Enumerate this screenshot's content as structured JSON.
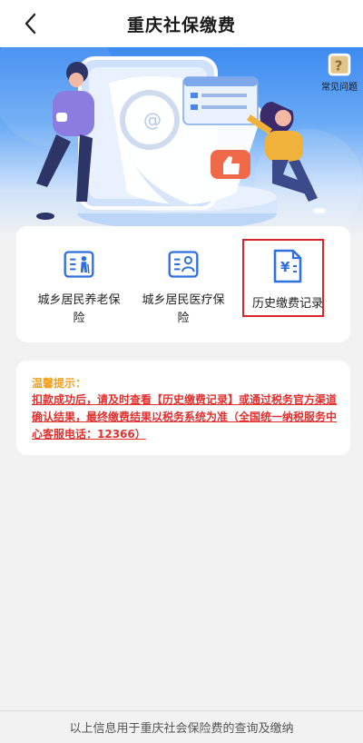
{
  "header": {
    "title": "重庆社保缴费",
    "back_icon": "chevron-left-icon"
  },
  "banner": {
    "faq_label": "常见问题",
    "faq_icon": "help-book-icon"
  },
  "menu": {
    "items": [
      {
        "label": "城乡居民养老保险",
        "icon": "pension-icon"
      },
      {
        "label": "城乡居民医疗保险",
        "icon": "medical-id-icon"
      },
      {
        "label": "历史缴费记录",
        "icon": "yuan-document-icon"
      }
    ]
  },
  "notice": {
    "title": "温馨提示：",
    "body": "扣款成功后，请及时查看【历史缴费记录】或通过税务官方渠道确认结果，最终缴费结果以税务系统为准（全国统一纳税服务中心客服电话：12366）"
  },
  "footer": {
    "text": "以上信息用于重庆社会保险费的查询及缴纳"
  },
  "colors": {
    "accent": "#2f6fe0",
    "warning": "#f0a020",
    "alert": "#e0312f",
    "highlight_box": "#d9232d"
  }
}
